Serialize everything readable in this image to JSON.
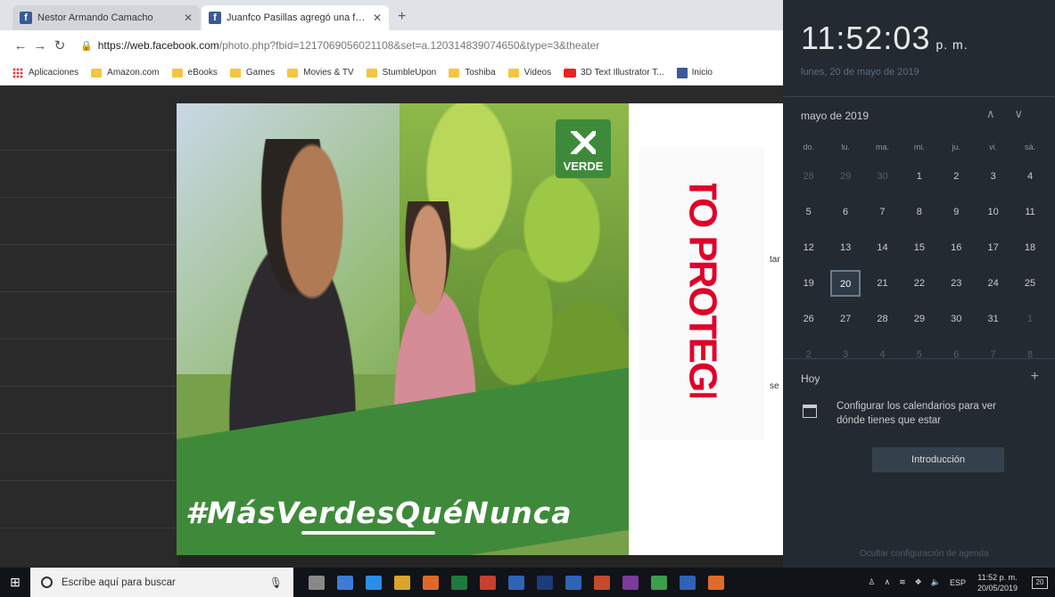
{
  "browser": {
    "tabs": [
      {
        "title": "Nestor Armando Camacho",
        "active": false
      },
      {
        "title": "Juanfco Pasillas agregó una foto",
        "active": true
      }
    ],
    "url_host": "https://web.facebook.com",
    "url_rest": "/photo.php?fbid=1217069056021108&set=a.120314839074650&type=3&theater",
    "bookmarks": [
      {
        "label": "Aplicaciones",
        "icon": "apps-icon"
      },
      {
        "label": "Amazon.com",
        "icon": "folder-icon"
      },
      {
        "label": "eBooks",
        "icon": "folder-icon"
      },
      {
        "label": "Games",
        "icon": "folder-icon"
      },
      {
        "label": "Movies & TV",
        "icon": "folder-icon"
      },
      {
        "label": "StumbleUpon",
        "icon": "folder-icon"
      },
      {
        "label": "Toshiba",
        "icon": "folder-icon"
      },
      {
        "label": "Videos",
        "icon": "folder-icon"
      },
      {
        "label": "3D Text Illustrator T...",
        "icon": "youtube-icon"
      },
      {
        "label": "Inicio",
        "icon": "facebook-icon"
      }
    ]
  },
  "photo": {
    "logo_text": "VERDE",
    "hashtag": "#MásVerdesQuéNunca",
    "redaction_text": "DATO PROTEGIDO",
    "side_fragment_1": "tar",
    "side_fragment_2": "se"
  },
  "flyout": {
    "time": "11:52:03",
    "ampm": "p. m.",
    "date_long": "lunes, 20 de mayo de 2019",
    "month_label": "mayo de 2019",
    "weekdays": [
      "do.",
      "lu.",
      "ma.",
      "mi.",
      "ju.",
      "vi.",
      "sá."
    ],
    "weeks": [
      [
        "28",
        "29",
        "30",
        "1",
        "2",
        "3",
        "4"
      ],
      [
        "5",
        "6",
        "7",
        "8",
        "9",
        "10",
        "11"
      ],
      [
        "12",
        "13",
        "14",
        "15",
        "16",
        "17",
        "18"
      ],
      [
        "19",
        "20",
        "21",
        "22",
        "23",
        "24",
        "25"
      ],
      [
        "26",
        "27",
        "28",
        "29",
        "30",
        "31",
        "1"
      ],
      [
        "2",
        "3",
        "4",
        "5",
        "6",
        "7",
        "8"
      ]
    ],
    "today": "20",
    "hoy_label": "Hoy",
    "configure_text": "Configurar los calendarios para ver dónde tienes que estar",
    "intro_button": "Introducción",
    "hide_agenda": "Ocultar configuración de agenda"
  },
  "taskbar": {
    "search_placeholder": "Escribe aquí para buscar",
    "language": "ESP",
    "time": "11:52 p. m.",
    "date": "20/05/2019",
    "notifications": "20",
    "app_colors": [
      "#888",
      "#3c7bd6",
      "#2a8ee8",
      "#d9a52a",
      "#e0692a",
      "#1e7a3c",
      "#c4402f",
      "#2f63b5",
      "#1d3b7a",
      "#2f63b5",
      "#c44a2a",
      "#7a3b9a",
      "#3a9e4c",
      "#2f63b5",
      "#e06a2a"
    ]
  }
}
